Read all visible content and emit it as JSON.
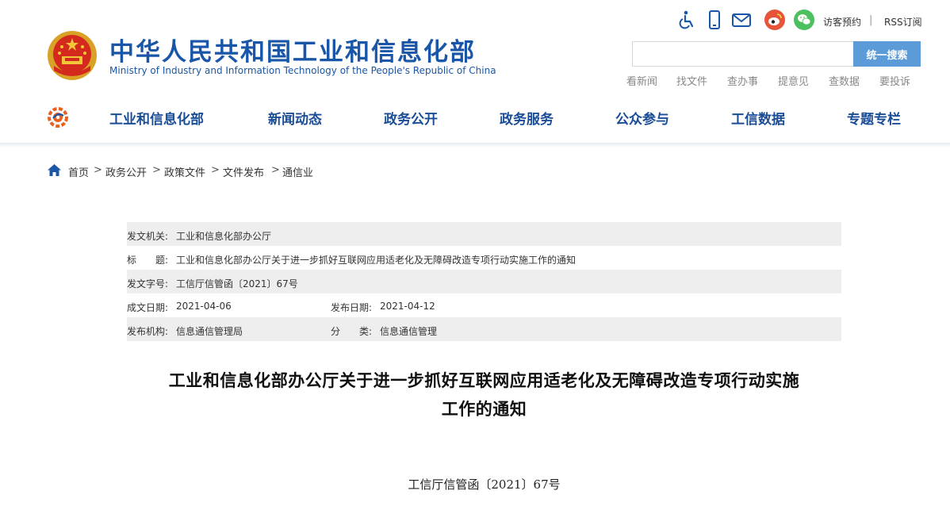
{
  "header": {
    "site_title": "中华人民共和国工业和信息化部",
    "site_subtitle": "Ministry of Industry and Information Technology of the People's Republic of China",
    "util_links": {
      "visitor": "访客预约",
      "separator": "|",
      "rss": "RSS订阅"
    },
    "icons": [
      "accessibility-icon",
      "mobile-icon",
      "mail-icon",
      "weibo-icon",
      "wechat-icon"
    ],
    "search": {
      "placeholder": "",
      "value": "",
      "button_label": "统一搜索"
    },
    "quick_links": [
      "看新闻",
      "找文件",
      "查办事",
      "提意见",
      "查数据",
      "要投诉"
    ]
  },
  "nav": {
    "items": [
      "工业和信息化部",
      "新闻动态",
      "政务公开",
      "政务服务",
      "公众参与",
      "工信数据",
      "专题专栏"
    ]
  },
  "breadcrumb": {
    "items": [
      "首页",
      "政务公开",
      "政策文件",
      "文件发布",
      "通信业"
    ],
    "separator": ">"
  },
  "info_table": {
    "issuer_label": "发文机关:",
    "issuer_value": "工业和信息化部办公厅",
    "title_label": "标　　题:",
    "title_value": "工业和信息化部办公厅关于进一步抓好互联网应用适老化及无障碍改造专项行动实施工作的通知",
    "docno_label": "发文字号:",
    "docno_value": "工信厅信管函〔2021〕67号",
    "created_label": "成文日期:",
    "created_value": "2021-04-06",
    "published_label": "发布日期:",
    "published_value": "2021-04-12",
    "agency_label": "发布机构:",
    "agency_value": "信息通信管理局",
    "category_label": "分　　类:",
    "category_value": "信息通信管理"
  },
  "article": {
    "title_line1": "工业和信息化部办公厅关于进一步抓好互联网应用适老化及无障碍改造专项行动实施",
    "title_line2": "工作的通知",
    "doc_number": "工信厅信管函〔2021〕67号"
  },
  "colors": {
    "brand_blue": "#1a56a8",
    "nav_blue": "#1a4d96",
    "search_button": "#5b9bd8",
    "weibo_red": "#e6553a",
    "wechat_green": "#4cbf5f",
    "row_shade": "#eeeeee"
  }
}
